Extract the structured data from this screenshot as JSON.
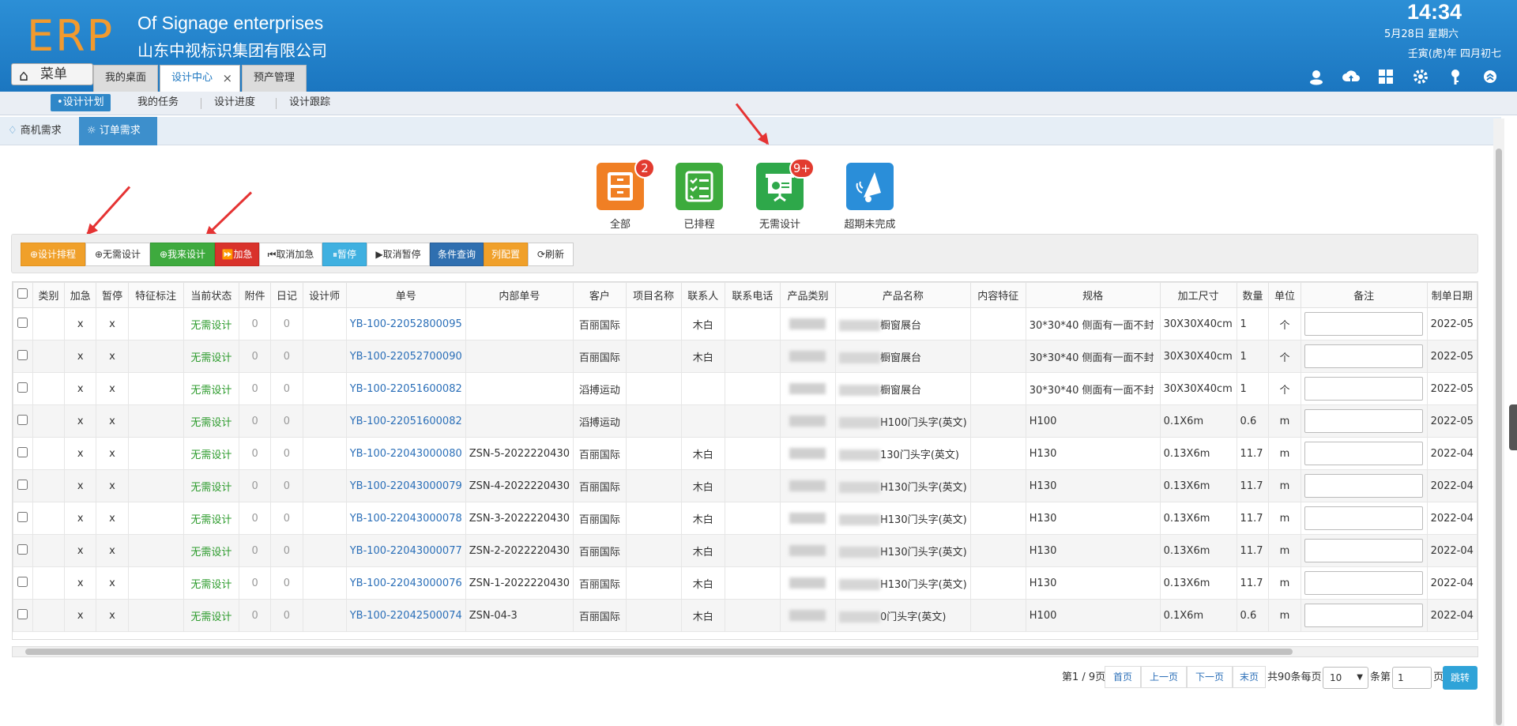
{
  "header": {
    "logo": "ERP",
    "company_en": "Of Signage enterprises",
    "company_cn": "山东中视标识集团有限公司",
    "time": "14:34",
    "date": "5月28日 星期六",
    "lunar": "壬寅(虎)年 四月初七",
    "menu_label": "菜单",
    "tabs": [
      {
        "label": "我的桌面"
      },
      {
        "label": "设计中心"
      },
      {
        "label": "预产管理"
      }
    ],
    "tab_close": "×",
    "icons": [
      "user-icon",
      "cloud-upload-icon",
      "grid-icon",
      "gear-icon",
      "key-icon",
      "collapse-icon"
    ]
  },
  "subnav": {
    "items": [
      "•设计计划",
      "我的任务",
      "设计进度",
      "设计跟踪"
    ]
  },
  "subtabs": [
    "商机需求",
    "订单需求"
  ],
  "tiles": [
    {
      "label": "全部",
      "badge": "2",
      "color": "#f07f24"
    },
    {
      "label": "已排程",
      "badge": "",
      "color": "#3dab3d"
    },
    {
      "label": "无需设计",
      "badge": "9+",
      "color": "#2ea84a"
    },
    {
      "label": "超期未完成",
      "badge": "",
      "color": "#2a8ed9"
    }
  ],
  "toolbar": {
    "buttons": [
      {
        "label": "⊕设计排程",
        "bg": "#f0a02a",
        "fg": "#fff"
      },
      {
        "label": "⊕无需设计",
        "bg": "#ffffff",
        "fg": "#333"
      },
      {
        "label": "⊕我来设计",
        "bg": "#3eaa3e",
        "fg": "#fff"
      },
      {
        "label": "⏩加急",
        "bg": "#d9322b",
        "fg": "#fff"
      },
      {
        "label": "⏮取消加急",
        "bg": "#ffffff",
        "fg": "#333"
      },
      {
        "label": "⏸暂停",
        "bg": "#3fb0e0",
        "fg": "#fff"
      },
      {
        "label": "▶取消暂停",
        "bg": "#ffffff",
        "fg": "#333"
      },
      {
        "label": "条件查询",
        "bg": "#2f6fb0",
        "fg": "#fff"
      },
      {
        "label": "列配置",
        "bg": "#f0a02a",
        "fg": "#fff"
      },
      {
        "label": "⟳刷新",
        "bg": "#ffffff",
        "fg": "#333"
      }
    ]
  },
  "table": {
    "columns": [
      "",
      "类别",
      "加急",
      "暂停",
      "特征标注",
      "当前状态",
      "附件",
      "日记",
      "设计师",
      "单号",
      "内部单号",
      "客户",
      "项目名称",
      "联系人",
      "联系电话",
      "产品类别",
      "产品名称",
      "内容特征",
      "规格",
      "加工尺寸",
      "数量",
      "单位",
      "备注",
      "制单日期"
    ],
    "rows": [
      {
        "urgent": "x",
        "pause": "x",
        "status": "无需设计",
        "att": "0",
        "diary": "0",
        "no": "YB-100-22052800095",
        "inner": "",
        "customer": "百丽国际",
        "contact": "木白",
        "product": "橱窗展台",
        "spec": "30*30*40 侧面有一面不封",
        "size": "30X30X40cm",
        "qty": "1",
        "unit": "个",
        "date": "2022-05"
      },
      {
        "urgent": "x",
        "pause": "x",
        "status": "无需设计",
        "att": "0",
        "diary": "0",
        "no": "YB-100-22052700090",
        "inner": "",
        "customer": "百丽国际",
        "contact": "木白",
        "product": "橱窗展台",
        "spec": "30*30*40 侧面有一面不封",
        "size": "30X30X40cm",
        "qty": "1",
        "unit": "个",
        "date": "2022-05"
      },
      {
        "urgent": "x",
        "pause": "x",
        "status": "无需设计",
        "att": "0",
        "diary": "0",
        "no": "YB-100-22051600082",
        "inner": "",
        "customer": "滔搏运动",
        "contact": "",
        "product": "橱窗展台",
        "spec": "30*30*40 侧面有一面不封",
        "size": "30X30X40cm",
        "qty": "1",
        "unit": "个",
        "date": "2022-05"
      },
      {
        "urgent": "x",
        "pause": "x",
        "status": "无需设计",
        "att": "0",
        "diary": "0",
        "no": "YB-100-22051600082",
        "inner": "",
        "customer": "滔搏运动",
        "contact": "",
        "product": "H100门头字(英文)",
        "spec": "H100",
        "size": "0.1X6m",
        "qty": "0.6",
        "unit": "m",
        "date": "2022-05"
      },
      {
        "urgent": "x",
        "pause": "x",
        "status": "无需设计",
        "att": "0",
        "diary": "0",
        "no": "YB-100-22043000080",
        "inner": "ZSN-5-2022220430",
        "customer": "百丽国际",
        "contact": "木白",
        "product": "130门头字(英文)",
        "spec": "H130",
        "size": "0.13X6m",
        "qty": "11.7",
        "unit": "m",
        "date": "2022-04"
      },
      {
        "urgent": "x",
        "pause": "x",
        "status": "无需设计",
        "att": "0",
        "diary": "0",
        "no": "YB-100-22043000079",
        "inner": "ZSN-4-2022220430",
        "customer": "百丽国际",
        "contact": "木白",
        "product": "H130门头字(英文)",
        "spec": "H130",
        "size": "0.13X6m",
        "qty": "11.7",
        "unit": "m",
        "date": "2022-04"
      },
      {
        "urgent": "x",
        "pause": "x",
        "status": "无需设计",
        "att": "0",
        "diary": "0",
        "no": "YB-100-22043000078",
        "inner": "ZSN-3-2022220430",
        "customer": "百丽国际",
        "contact": "木白",
        "product": "H130门头字(英文)",
        "spec": "H130",
        "size": "0.13X6m",
        "qty": "11.7",
        "unit": "m",
        "date": "2022-04"
      },
      {
        "urgent": "x",
        "pause": "x",
        "status": "无需设计",
        "att": "0",
        "diary": "0",
        "no": "YB-100-22043000077",
        "inner": "ZSN-2-2022220430",
        "customer": "百丽国际",
        "contact": "木白",
        "product": "H130门头字(英文)",
        "spec": "H130",
        "size": "0.13X6m",
        "qty": "11.7",
        "unit": "m",
        "date": "2022-04"
      },
      {
        "urgent": "x",
        "pause": "x",
        "status": "无需设计",
        "att": "0",
        "diary": "0",
        "no": "YB-100-22043000076",
        "inner": "ZSN-1-2022220430",
        "customer": "百丽国际",
        "contact": "木白",
        "product": "H130门头字(英文)",
        "spec": "H130",
        "size": "0.13X6m",
        "qty": "11.7",
        "unit": "m",
        "date": "2022-04"
      },
      {
        "urgent": "x",
        "pause": "x",
        "status": "无需设计",
        "att": "0",
        "diary": "0",
        "no": "YB-100-22042500074",
        "inner": "ZSN-04-3",
        "customer": "百丽国际",
        "contact": "木白",
        "product": "0门头字(英文)",
        "spec": "H100",
        "size": "0.1X6m",
        "qty": "0.6",
        "unit": "m",
        "date": "2022-04"
      }
    ]
  },
  "pager": {
    "page_info": "第1 / 9页",
    "first": "首页",
    "prev": "上一页",
    "next": "下一页",
    "last": "末页",
    "total": "共90条每页",
    "per_page": "10",
    "goto_prefix": "条第",
    "goto_value": "1",
    "goto_suffix": "页",
    "go": "跳转"
  }
}
